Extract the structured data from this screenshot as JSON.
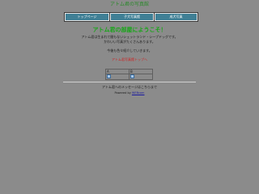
{
  "site_title": "アトム君の写真館",
  "nav": [
    {
      "label": "トップページ"
    },
    {
      "label": "子犬写真館"
    },
    {
      "label": "成犬写真"
    }
  ],
  "welcome": "アトム君の部屋にようこそ！",
  "description": {
    "line1": "アトム君は生まれて間もないシェットランド・シープドッグです。",
    "line2": "かわいい写真がたくさんあります。",
    "line3": "今後も色々紹介していきます。"
  },
  "featured_link": "アトム君写真館トップへ",
  "gallery": {
    "headers": [
      "A",
      "B"
    ]
  },
  "footer": {
    "message": "アトム君へのメッセージはこちらまで",
    "powered_prefix": "Powered by",
    "powered_link": "WEBcom"
  }
}
